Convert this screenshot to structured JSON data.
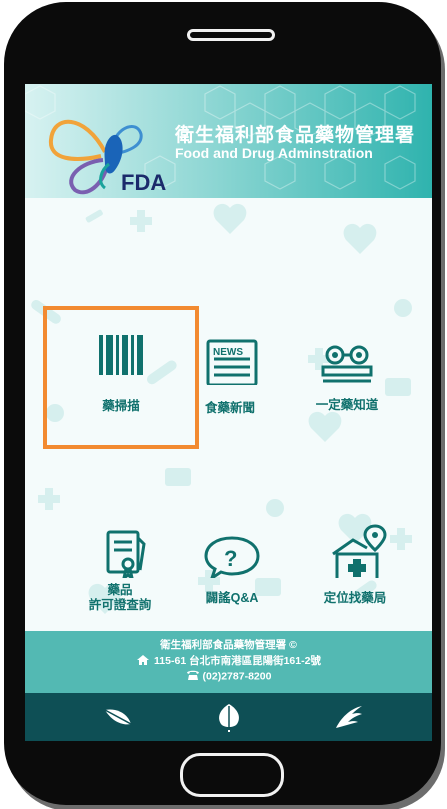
{
  "header": {
    "org_name_zh": "衛生福利部食品藥物管理署",
    "org_name_en": "Food and Drug Adminstration",
    "logo_text": "FDA"
  },
  "menu": {
    "items": [
      {
        "label": "藥掃描",
        "icon": "barcode-icon"
      },
      {
        "label": "食藥新聞",
        "icon": "newspaper-icon"
      },
      {
        "label": "一定藥知道",
        "icon": "glasses-book-icon"
      },
      {
        "label_line1": "藥品",
        "label_line2": "許可證查詢",
        "icon": "document-certificate-icon"
      },
      {
        "label": "闢謠Q&A",
        "icon": "question-bubble-icon"
      },
      {
        "label": "定位找藥局",
        "icon": "pharmacy-location-icon"
      }
    ],
    "selected_index": 0
  },
  "footer": {
    "org": "衛生福利部食品藥物管理署 ©",
    "address": "115-61 台北市南港區昆陽街161-2號",
    "phone": "(02)2787-8200"
  },
  "nav": {
    "items": [
      "feather-icon",
      "leaf-icon",
      "palm-leaf-icon"
    ]
  },
  "colors": {
    "primary_teal": "#10716d",
    "header_teal": "#2fb3ae",
    "footer_teal": "#53b9b3",
    "navbar": "#0e4f55",
    "highlight": "#f28a30"
  }
}
